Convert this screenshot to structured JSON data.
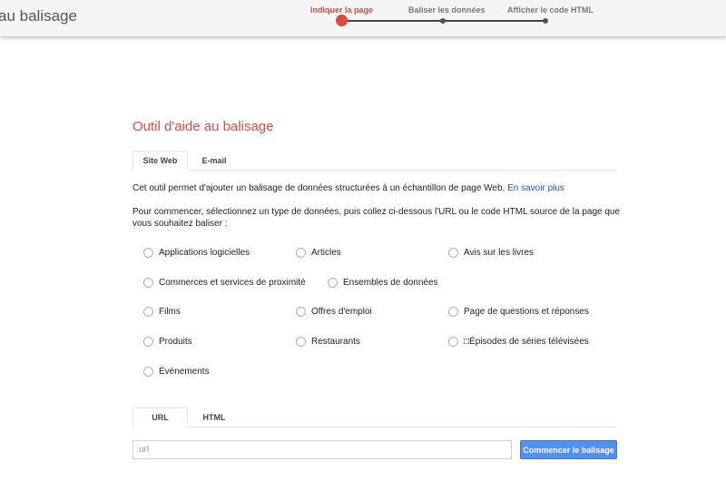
{
  "header": {
    "app_title": "au balisage",
    "steps": [
      {
        "label": "Indiquer la page",
        "active": true
      },
      {
        "label": "Baliser les données",
        "active": false
      },
      {
        "label": "Afficher le code HTML",
        "active": false
      }
    ]
  },
  "main": {
    "title": "Outil d'aide au balisage",
    "source_tabs": [
      {
        "label": "Site Web",
        "active": true
      },
      {
        "label": "E-mail",
        "active": false
      }
    ],
    "intro_text": "Cet outil permet d'ajouter un balisage de données structurées à un échantillon de page Web.",
    "learn_more": "En savoir plus",
    "instruction": "Pour commencer, sélectionnez un type de données, puis collez ci-dessous l'URL ou le code HTML source de la page que vous souhaitez baliser :",
    "data_types": [
      "Applications logicielles",
      "Articles",
      "Avis sur les livres",
      "Commerces et services de proximité",
      "Ensembles de données",
      "Films",
      "Offres d'emploi",
      "Page de questions et réponses",
      "Produits",
      "Restaurants",
      "□Épisodes de séries télévisées",
      "Événements"
    ],
    "input_tabs": [
      {
        "label": "URL",
        "active": true
      },
      {
        "label": "HTML",
        "active": false
      }
    ],
    "url_placeholder": "url",
    "start_button": "Commencer le balisage"
  },
  "colors": {
    "accent_red": "#dd4b39",
    "link_blue": "#1a57c4",
    "button_blue": "#4d90fe"
  }
}
